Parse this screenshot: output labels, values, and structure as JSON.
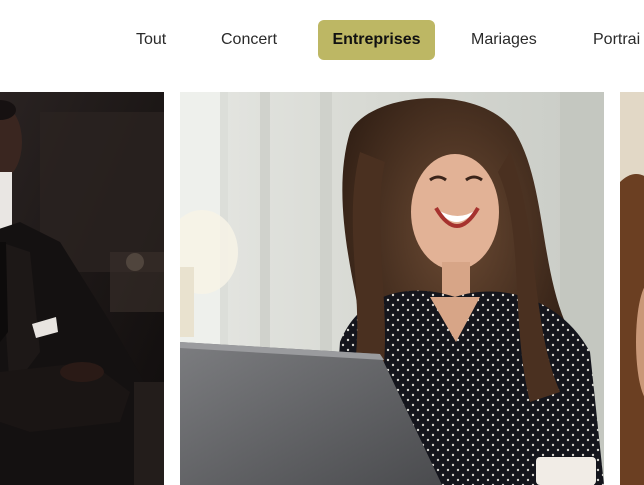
{
  "filters": {
    "items": [
      {
        "label": "Tout",
        "active": false
      },
      {
        "label": "Concert",
        "active": false
      },
      {
        "label": "Entreprises",
        "active": true
      },
      {
        "label": "Mariages",
        "active": false
      },
      {
        "label": "Portrai",
        "active": false
      }
    ],
    "active_color": "#bdb764"
  },
  "gallery": {
    "photos": [
      {
        "subject": "man-in-suit-arms-crossed"
      },
      {
        "subject": "laughing-woman-with-laptop"
      },
      {
        "subject": "partial-portrait-cropped"
      }
    ]
  }
}
